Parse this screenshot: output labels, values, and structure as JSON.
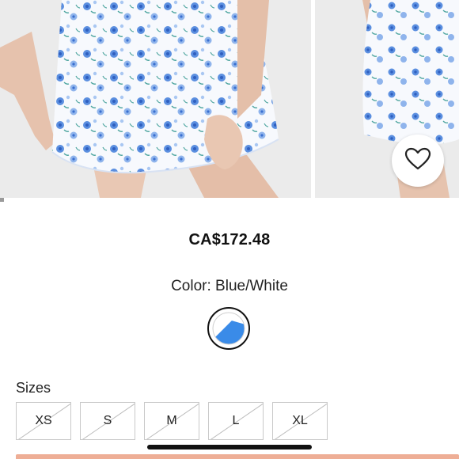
{
  "product": {
    "price": "CA$172.48",
    "color_label": "Color:",
    "color_value": "Blue/White",
    "color_swatch": {
      "name": "blue-white",
      "colors": [
        "#ffffff",
        "#3a8be8"
      ]
    }
  },
  "gallery": {
    "images": [
      "model-front-floral-skirt",
      "model-side-floral-skirt"
    ],
    "active_index": 0,
    "wishlist_icon": "heart-outline-icon"
  },
  "sizes": {
    "label": "Sizes",
    "options": [
      {
        "label": "XS",
        "available": false
      },
      {
        "label": "S",
        "available": false
      },
      {
        "label": "M",
        "available": false
      },
      {
        "label": "L",
        "available": false
      },
      {
        "label": "XL",
        "available": false
      }
    ]
  },
  "colors": {
    "print_blue": "#5b8fe0",
    "print_light": "#a9c7f2",
    "leaf_green": "#4fa6a0",
    "skin": "#e9c8b4",
    "accent_button": "#eeae96"
  }
}
